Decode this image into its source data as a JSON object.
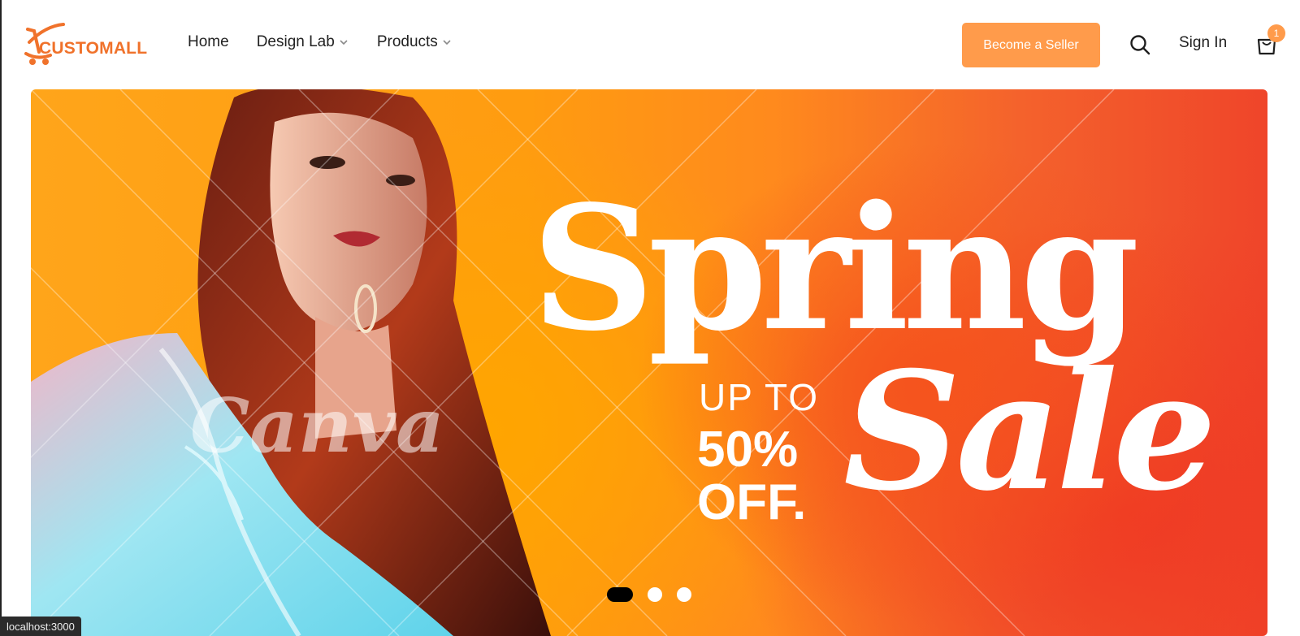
{
  "header": {
    "logo_text": "CUSTOMALL",
    "nav": [
      {
        "label": "Home",
        "has_dropdown": false
      },
      {
        "label": "Design Lab",
        "has_dropdown": true
      },
      {
        "label": "Products",
        "has_dropdown": true
      }
    ],
    "seller_button": "Become a Seller",
    "sign_in": "Sign In",
    "cart_count": "1"
  },
  "hero": {
    "headline": "Spring",
    "subheadline": "Sale",
    "offer_line1": "UP TO",
    "offer_line2": "50%",
    "offer_line3": "OFF.",
    "watermark": "Canva",
    "slides": 3,
    "active_slide": 1
  },
  "status_bar": {
    "url": "localhost:3000"
  },
  "colors": {
    "accent": "#ff9b4b",
    "logo": "#f0722b",
    "hero_orange": "#ffa51a",
    "hero_red": "#ef452a"
  },
  "icons": {
    "search": "search-icon",
    "cart": "shopping-bag-icon",
    "chevron": "chevron-down-icon",
    "logo": "cart-swoosh-logo-icon"
  }
}
